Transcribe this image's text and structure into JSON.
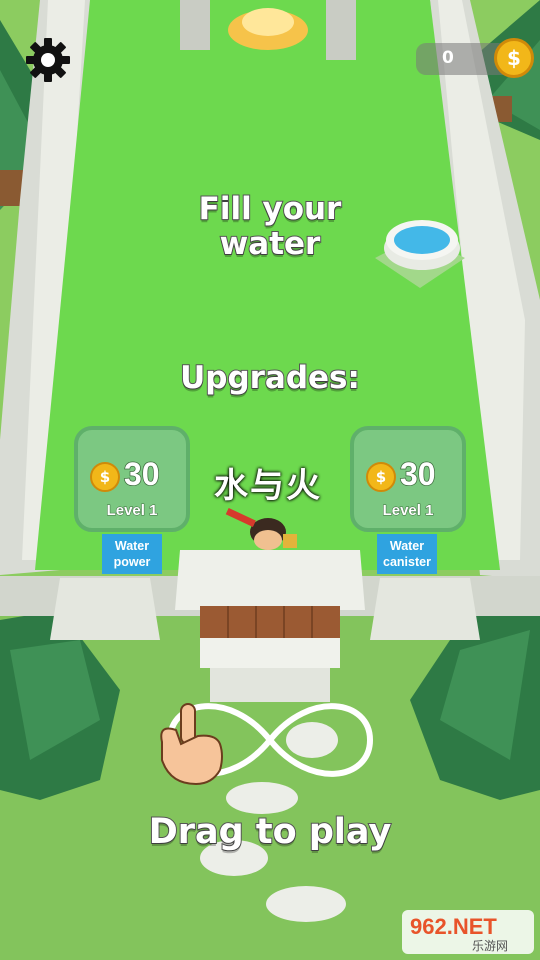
{
  "hud": {
    "coin_count": "0",
    "coin_symbol": "$"
  },
  "instructions": {
    "title": "Fill your water",
    "upgrades_heading": "Upgrades:",
    "drag_hint": "Drag to play"
  },
  "upgrades": [
    {
      "cost": "30",
      "level": "Level 1",
      "label": "Water power"
    },
    {
      "cost": "30",
      "level": "Level 1",
      "label": "Water canister"
    }
  ],
  "watermark": "水与火",
  "branding": {
    "site": "962.NET",
    "subtitle": "乐游网"
  },
  "icons": {
    "settings": "gear-icon",
    "coin": "dollar-coin-icon",
    "hand": "pointing-hand-icon",
    "path": "infinity-path-icon",
    "well": "well-icon"
  }
}
